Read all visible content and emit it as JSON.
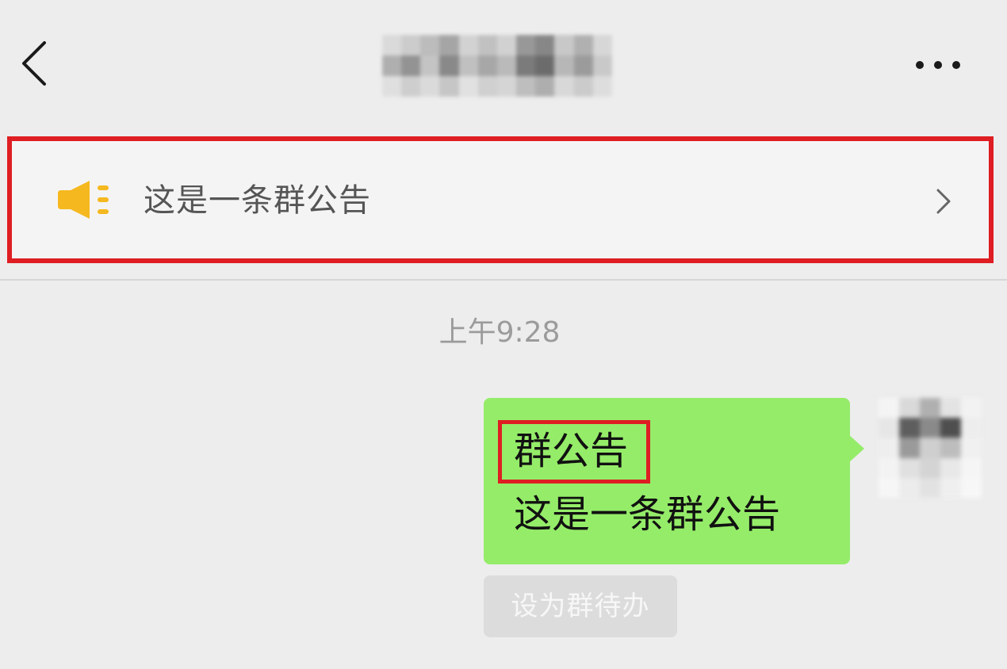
{
  "header": {
    "back_icon": "chevron-left-icon",
    "more_icon": "more-horizontal-icon"
  },
  "announcement": {
    "icon": "megaphone-icon",
    "icon_color": "#f5b81f",
    "text": "这是一条群公告",
    "chevron_icon": "chevron-right-icon",
    "highlight_color": "#de1e22"
  },
  "chat": {
    "timestamp": "上午9:28",
    "message": {
      "title": "群公告",
      "body": "这是一条群公告",
      "bubble_color": "#95ec69"
    },
    "action_chip": "设为群待办"
  }
}
